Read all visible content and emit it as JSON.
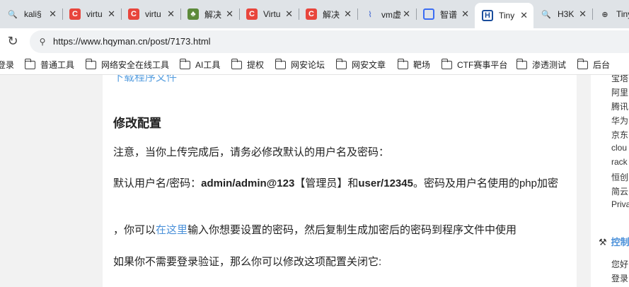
{
  "tabs": [
    {
      "icon": "search-icon",
      "label": "kali§",
      "active": false
    },
    {
      "icon": "c-logo-icon",
      "label": "virtu",
      "active": false
    },
    {
      "icon": "c-logo-icon",
      "label": "virtu",
      "active": false
    },
    {
      "icon": "tree-icon",
      "label": "解决",
      "active": false
    },
    {
      "icon": "c-logo-icon",
      "label": "Virtu",
      "active": false
    },
    {
      "icon": "c-logo-icon",
      "label": "解决",
      "active": false
    },
    {
      "icon": "vm-icon",
      "label": "vm虚",
      "active": false
    },
    {
      "icon": "zhi-icon",
      "label": "智谱",
      "active": false
    },
    {
      "icon": "h-logo-icon",
      "label": "Tiny",
      "active": true
    },
    {
      "icon": "search-icon",
      "label": "H3K",
      "active": false
    },
    {
      "icon": "globe-icon",
      "label": "Tiny",
      "active": false
    }
  ],
  "tab_close": "✕",
  "address": {
    "url": "https://www.hqyman.cn/post/7173.html"
  },
  "bookmarks": [
    "登录",
    "普通工具",
    "网络安全在线工具",
    "AI工具",
    "提权",
    "网安论坛",
    "网安文章",
    "靶场",
    "CTF赛事平台",
    "渗透测试",
    "后台"
  ],
  "article": {
    "cut_link": "下载程序文件",
    "heading": "修改配置",
    "p1": "注意，当你上传完成后，请务必修改默认的用户名及密码：",
    "p2_prefix": "默认用户名/密码：",
    "p2_admin": "admin/admin@123",
    "p2_admin_role": "【管理员】",
    "p2_and": "和",
    "p2_user": "user/12345",
    "p2_suffix": "。密码及用户名使用的php加密",
    "p3_prefix": "，你可以",
    "p3_link": "在这里",
    "p3_suffix": "输入你想要设置的密码，然后复制生成加密后的密码到程序文件中使用",
    "p4": "如果你不需要登录验证，那么你可以修改这项配置关闭它:"
  },
  "sidebar": {
    "items": [
      "宝塔",
      "阿里",
      "腾讯",
      "华为",
      "京东",
      "clou",
      "rack",
      "恒创",
      "简云",
      "Priva"
    ],
    "section_title": "控制",
    "section_items": [
      "您好",
      "登录"
    ]
  }
}
